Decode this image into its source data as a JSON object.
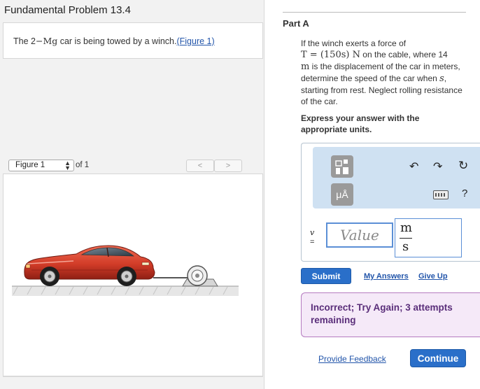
{
  "problem": {
    "title": "Fundamental Problem 13.4",
    "text_before": "The 2",
    "text_math": "−Mg",
    "text_after": " car is being towed by a winch.",
    "figure_link": "(Figure 1)"
  },
  "figure_viewer": {
    "selected": "Figure 1",
    "of_label": "of 1",
    "prev_label": "<",
    "next_label": ">"
  },
  "part": {
    "title": "Part A",
    "q1": "If the winch exerts a force of",
    "q_math": "T = (150s) N",
    "q2": " on the cable, where 14",
    "q_m": "m",
    "q3": " is the displacement of the car in meters, determine the speed of the car when ",
    "q_s": "s",
    "q4": ", starting from rest. Neglect rolling resistance of the car.",
    "instruction": "Express your answer with the appropriate units."
  },
  "toolbar": {
    "templates_icon": "templates-icon",
    "units_label": "μÅ",
    "undo_icon": "undo-icon",
    "redo_icon": "redo-icon",
    "reset_icon": "reset-icon",
    "keyboard_icon": "keyboard-icon",
    "help_label": "?"
  },
  "answer": {
    "variable": "v",
    "equals": "=",
    "value": "",
    "placeholder": "Value",
    "unit_numerator": "m",
    "unit_denominator": "s"
  },
  "actions": {
    "submit": "Submit",
    "my_answers": "My Answers",
    "give_up": "Give Up",
    "provide_feedback": "Provide Feedback",
    "continue": "Continue"
  },
  "feedback": {
    "message": "Incorrect; Try Again; 3 attempts remaining"
  },
  "colors": {
    "accent": "#2a6fc9",
    "toolbar_bg": "#cfe1f2",
    "feedback_bg": "#f5e9f8",
    "feedback_text": "#5a2e7a",
    "car": "#d23c28"
  }
}
